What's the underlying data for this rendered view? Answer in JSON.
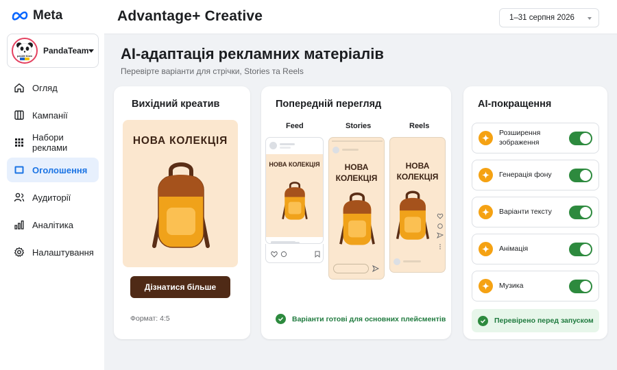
{
  "brand": {
    "name": "Meta",
    "color": "#0866ff"
  },
  "account": {
    "name": "PandaTeam",
    "avatar_text": "panda team"
  },
  "nav": {
    "items": [
      {
        "label": "Огляд",
        "icon": "home-icon"
      },
      {
        "label": "Кампанії",
        "icon": "columns-icon"
      },
      {
        "label": "Набори реклами",
        "icon": "grid-icon"
      },
      {
        "label": "Оголошення",
        "icon": "ad-icon",
        "active": true
      },
      {
        "label": "Аудиторії",
        "icon": "audience-icon"
      },
      {
        "label": "Аналітика",
        "icon": "analytics-icon"
      },
      {
        "label": "Налаштування",
        "icon": "gear-icon"
      }
    ]
  },
  "header": {
    "title": "Advantage+ Creative",
    "date_range": "1–31 серпня 2026"
  },
  "page": {
    "title": "AI-адаптація рекламних матеріалів",
    "subtitle": "Перевірте варіанти для стрічки, Stories та Reels"
  },
  "source": {
    "title": "Вихідний креатив",
    "headline": "НОВА КОЛЕКЦІЯ",
    "cta": "Дізнатися більше",
    "format": "Формат: 4:5"
  },
  "preview": {
    "title": "Попередній перегляд",
    "feed_label": "Feed",
    "stories_label": "Stories",
    "reels_label": "Reels",
    "feed_headline": "НОВА КОЛЕКЦІЯ",
    "stories_headline_1": "НОВА",
    "stories_headline_2": "КОЛЕКЦІЯ",
    "reels_headline_1": "НОВА",
    "reels_headline_2": "КОЛЕКЦІЯ",
    "ready_text": "Варіанти готові для основних плейсментів"
  },
  "ai": {
    "title": "AI-покращення",
    "features": [
      {
        "label_1": "Розширення",
        "label_2": "зображення",
        "enabled": true
      },
      {
        "label_1": "Генерація фону",
        "enabled": true
      },
      {
        "label_1": "Варіанти тексту",
        "enabled": true
      },
      {
        "label_1": "Анімація",
        "enabled": true
      },
      {
        "label_1": "Музика",
        "enabled": true
      }
    ],
    "verified_text": "Перевірено перед запуском"
  },
  "colors": {
    "accent": "#1b74e4",
    "cta": "#4f2a16",
    "creative_bg": "#fbe7cf",
    "toggle_on": "#2d8a3e",
    "spark": "#f5a213"
  }
}
